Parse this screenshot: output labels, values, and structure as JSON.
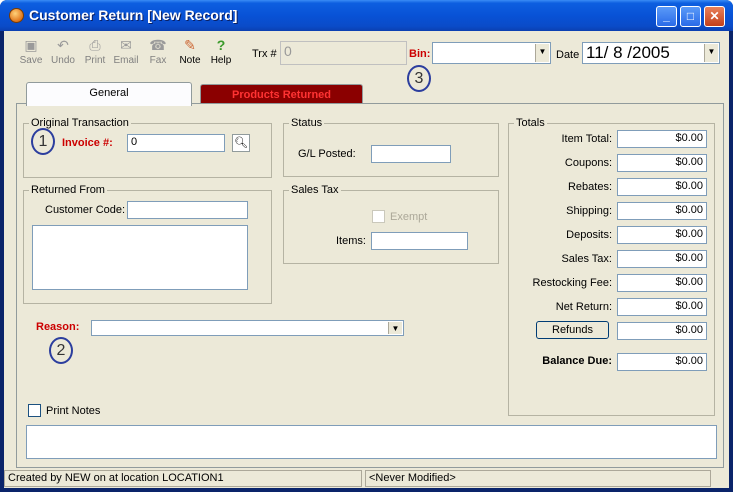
{
  "window": {
    "title": "Customer Return [New Record]"
  },
  "toolbar": {
    "buttons": [
      {
        "label": "Save"
      },
      {
        "label": "Undo"
      },
      {
        "label": "Print"
      },
      {
        "label": "Email"
      },
      {
        "label": "Fax"
      },
      {
        "label": "Note"
      },
      {
        "label": "Help"
      }
    ],
    "trx_label": "Trx #",
    "trx_value": "0",
    "bin_label": "Bin:",
    "bin_value": "",
    "date_label": "Date",
    "date_value": "11/ 8 /2005"
  },
  "tabs": {
    "general": "General",
    "products": "Products Returned"
  },
  "original_transaction": {
    "legend": "Original Transaction",
    "invoice_label": "Invoice #:",
    "invoice_value": "0"
  },
  "returned_from": {
    "legend": "Returned From",
    "customer_code_label": "Customer Code:",
    "customer_code_value": ""
  },
  "status": {
    "legend": "Status",
    "gl_posted_label": "G/L Posted:",
    "gl_posted_value": ""
  },
  "sales_tax": {
    "legend": "Sales Tax",
    "exempt_label": "Exempt",
    "items_label": "Items:",
    "items_value": ""
  },
  "reason": {
    "label": "Reason:",
    "value": ""
  },
  "print_notes": {
    "label": "Print Notes"
  },
  "totals": {
    "legend": "Totals",
    "rows": [
      {
        "label": "Item Total:",
        "value": "$0.00"
      },
      {
        "label": "Coupons:",
        "value": "$0.00"
      },
      {
        "label": "Rebates:",
        "value": "$0.00"
      },
      {
        "label": "Shipping:",
        "value": "$0.00"
      },
      {
        "label": "Deposits:",
        "value": "$0.00"
      },
      {
        "label": "Sales Tax:",
        "value": "$0.00"
      },
      {
        "label": "Restocking Fee:",
        "value": "$0.00"
      },
      {
        "label": "Net Return:",
        "value": "$0.00"
      }
    ],
    "refunds_label": "Refunds",
    "refunds_value": "$0.00",
    "balance_label": "Balance Due:",
    "balance_value": "$0.00"
  },
  "annotations": [
    "1",
    "2",
    "3"
  ],
  "statusbar": {
    "left": "Created by NEW on  at location LOCATION1",
    "right": "<Never Modified>"
  },
  "colors": {
    "title_blue": "#0852d6",
    "accent_red": "#cc0000",
    "tab_products": "#8b0000"
  }
}
